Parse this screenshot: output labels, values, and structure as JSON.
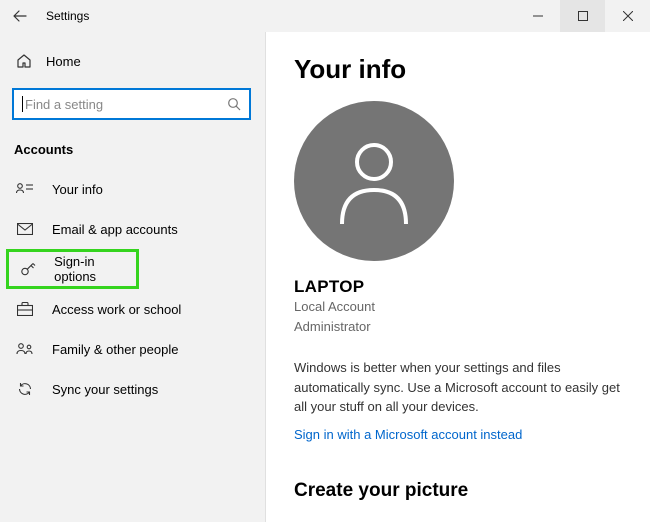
{
  "titlebar": {
    "title": "Settings"
  },
  "sidebar": {
    "home_label": "Home",
    "search_placeholder": "Find a setting",
    "section_label": "Accounts",
    "items": [
      {
        "label": "Your info"
      },
      {
        "label": "Email & app accounts"
      },
      {
        "label": "Sign-in options"
      },
      {
        "label": "Access work or school"
      },
      {
        "label": "Family & other people"
      },
      {
        "label": "Sync your settings"
      }
    ]
  },
  "main": {
    "heading": "Your info",
    "account_name": "LAPTOP",
    "account_type": "Local Account",
    "account_role": "Administrator",
    "sync_text": "Windows is better when your settings and files automatically sync. Use a Microsoft account to easily get all your stuff on all your devices.",
    "ms_link": "Sign in with a Microsoft account instead",
    "picture_heading": "Create your picture"
  }
}
